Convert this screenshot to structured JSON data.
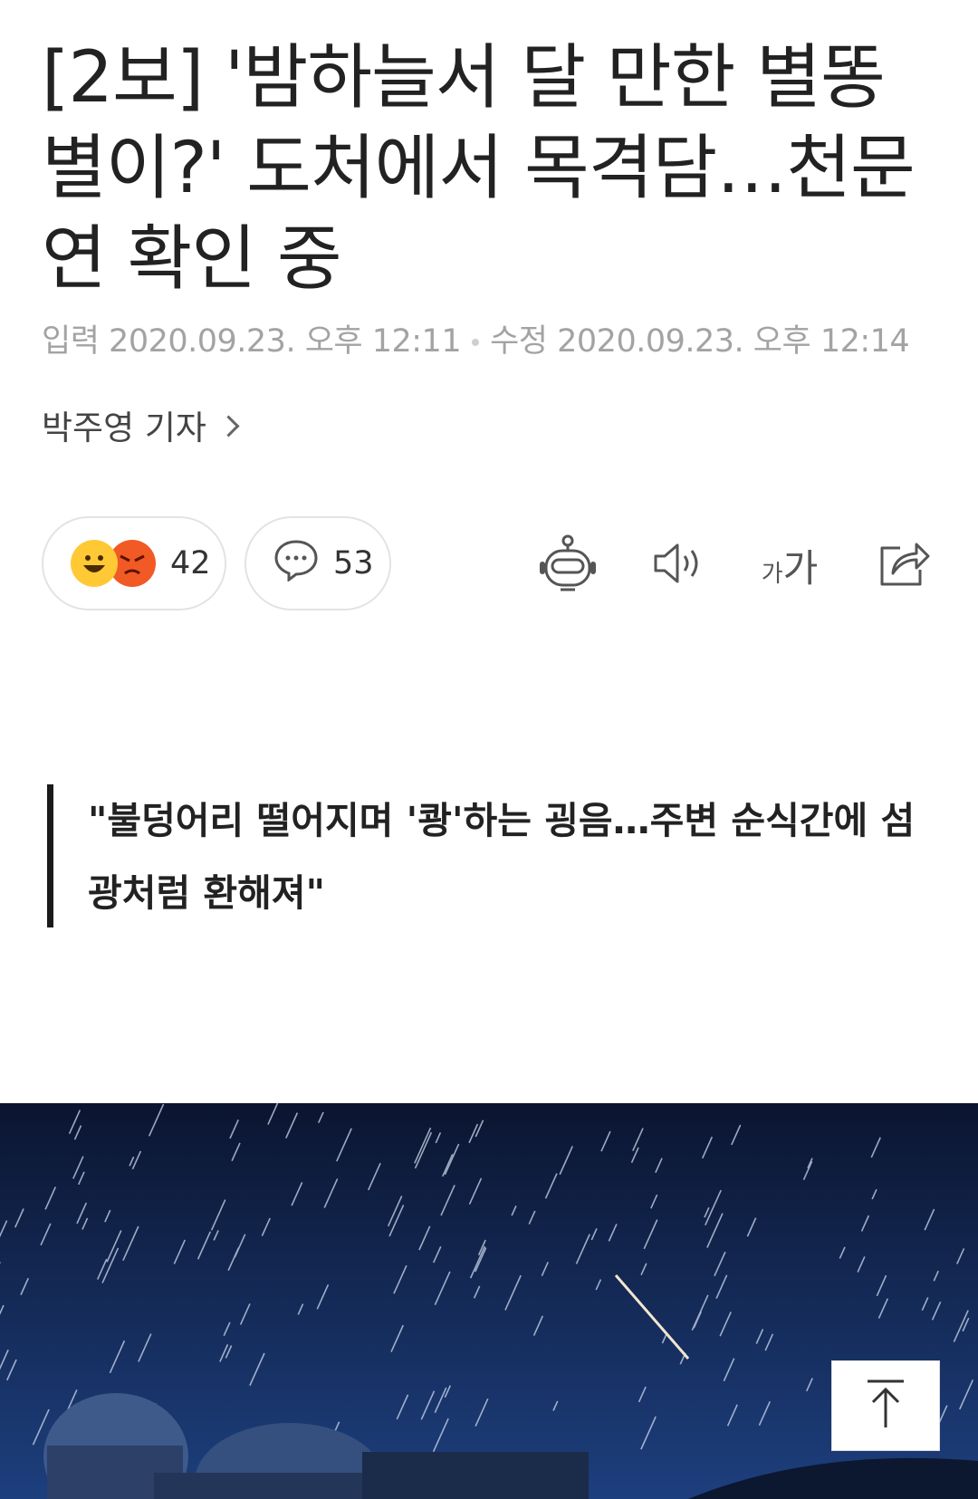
{
  "article": {
    "title": "[2보] '밤하늘서 달 만한 별똥별이?' 도처에서 목격담…천문연 확인 중",
    "input_label": "입력",
    "input_time": "2020.09.23. 오후 12:11",
    "modified_label": "수정",
    "modified_time": "2020.09.23. 오후 12:14",
    "author": "박주영 기자",
    "subtitle": "\"불덩어리 떨어지며 '쾅'하는 굉음…주변 순식간에 섬광처럼 환해져\""
  },
  "actions": {
    "reaction_count": "42",
    "comment_count": "53",
    "font_size_small": "가",
    "font_size_large": "가"
  },
  "icons": [
    "happy-emoji-icon",
    "angry-emoji-icon",
    "comment-icon",
    "robot-summary-icon",
    "speaker-icon",
    "font-size-icon",
    "share-icon",
    "arrow-up-icon"
  ],
  "colors": {
    "reaction_yellow": "#ffc935",
    "reaction_red": "#f15a24",
    "photo_sky": "#152a55"
  }
}
